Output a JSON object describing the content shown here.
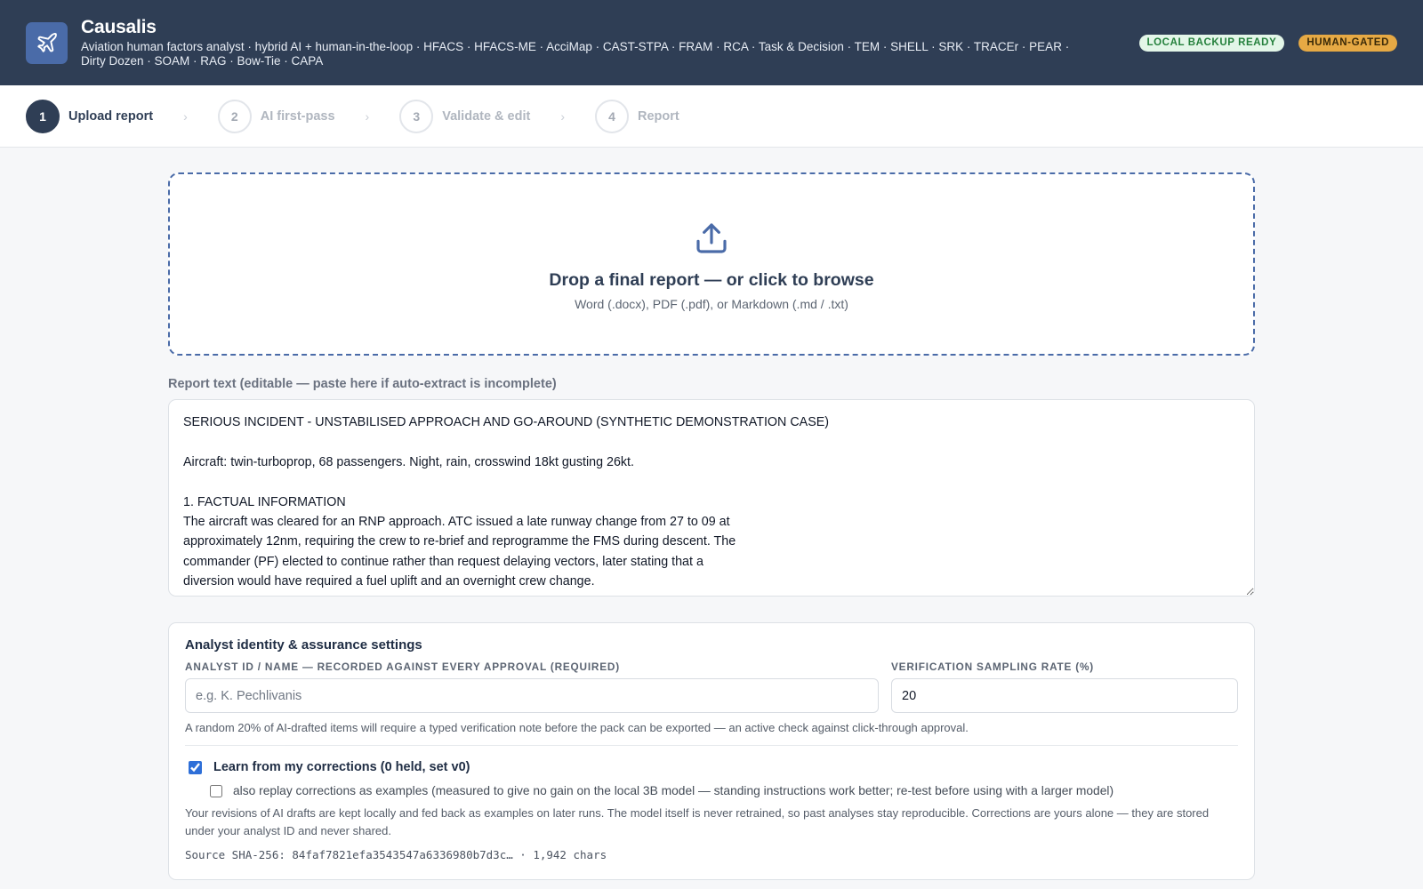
{
  "header": {
    "title": "Causalis",
    "subtitle": "Aviation human factors analyst · hybrid AI + human-in-the-loop · HFACS · HFACS-ME · AcciMap · CAST-STPA · FRAM · RCA · Task & Decision · TEM · SHELL · SRK · TRACEr · PEAR · Dirty Dozen · SOAM · RAG · Bow-Tie · CAPA",
    "logo_icon": "airplane-icon",
    "badges": {
      "backup": "LOCAL BACKUP READY",
      "gated": "HUMAN-GATED"
    },
    "colors": {
      "header_bg": "#2f3e55",
      "logo_bg": "#4a6ba8",
      "badge_backup_bg": "#e3f6e8",
      "badge_backup_text": "#24803c",
      "badge_gated_bg": "#e6a944"
    }
  },
  "stepper": {
    "steps": [
      {
        "number": "1",
        "label": "Upload report",
        "active": true
      },
      {
        "number": "2",
        "label": "AI first-pass",
        "active": false
      },
      {
        "number": "3",
        "label": "Validate & edit",
        "active": false
      },
      {
        "number": "4",
        "label": "Report",
        "active": false
      }
    ],
    "separator_icon": "chevron-right-icon"
  },
  "dropzone": {
    "icon": "upload-icon",
    "title": "Drop a final report — or click to browse",
    "subtitle": "Word (.docx), PDF (.pdf), or Markdown (.md / .txt)"
  },
  "report": {
    "label": "Report text (editable — paste here if auto-extract is incomplete)",
    "text": "SERIOUS INCIDENT - UNSTABILISED APPROACH AND GO-AROUND (SYNTHETIC DEMONSTRATION CASE)\n\nAircraft: twin-turboprop, 68 passengers. Night, rain, crosswind 18kt gusting 26kt.\n\n1. FACTUAL INFORMATION\nThe aircraft was cleared for an RNP approach. ATC issued a late runway change from 27 to 09 at\napproximately 12nm, requiring the crew to re-brief and reprogramme the FMS during descent. The\ncommander (PF) elected to continue rather than request delaying vectors, later stating that a\ndiversion would have required a fuel uplift and an overnight crew change."
  },
  "settings": {
    "title": "Analyst identity & assurance settings",
    "analyst_label": "ANALYST ID / NAME — RECORDED AGAINST EVERY APPROVAL (REQUIRED)",
    "analyst_placeholder": "e.g. K. Pechlivanis",
    "analyst_value": "",
    "rate_label": "VERIFICATION SAMPLING RATE (%)",
    "rate_value": "20",
    "rate_helper": "A random 20% of AI-drafted items will require a typed verification note before the pack can be exported — an active check against click-through approval.",
    "learn_label": "Learn from my corrections (0 held, set v0)",
    "learn_checked": true,
    "replay_label": "also replay corrections as examples (measured to give no gain on the local 3B model — standing instructions work better; re-test before using with a larger model)",
    "replay_checked": false,
    "explain": "Your revisions of AI drafts are kept locally and fed back as examples on later runs. The model itself is never retrained, so past analyses stay reproducible. Corrections are yours alone — they are stored under your analyst ID and never shared.",
    "sha": "Source SHA-256: 84faf7821efa3543547a6336980b7d3c… · 1,942 chars"
  }
}
